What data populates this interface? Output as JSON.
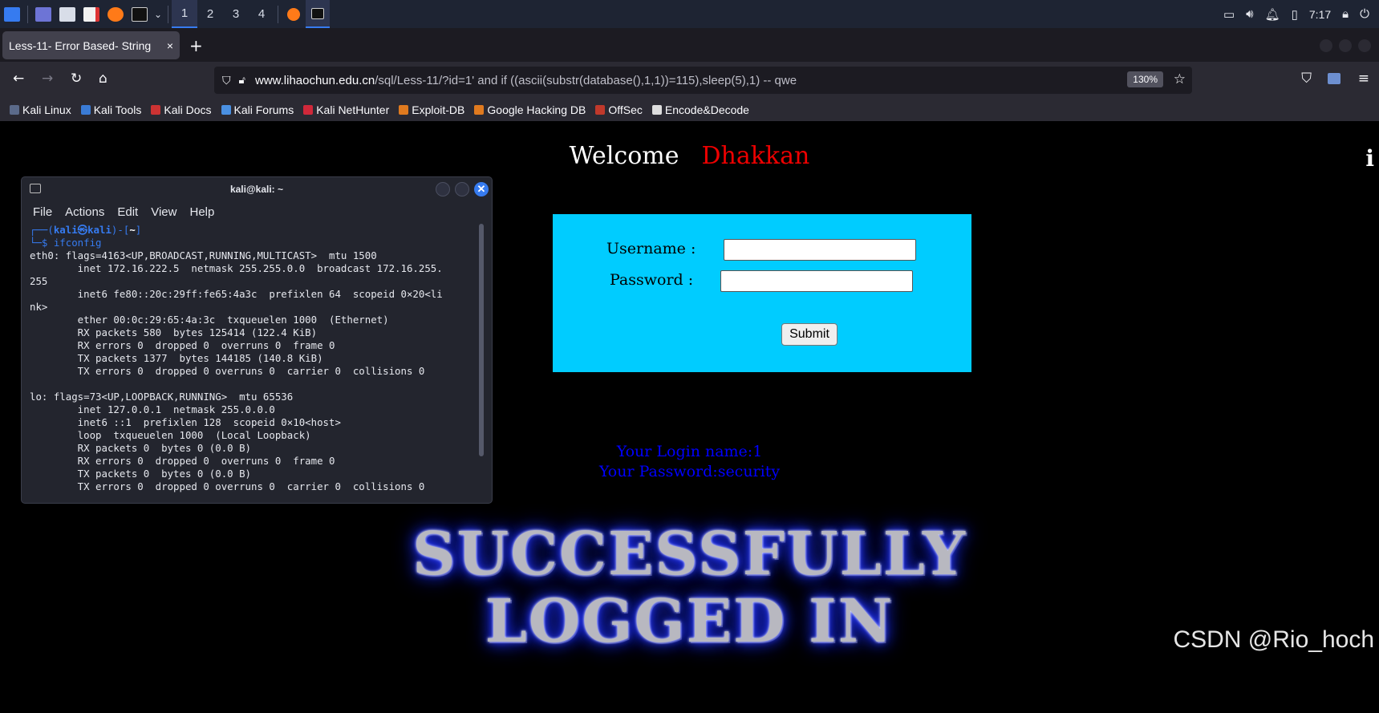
{
  "taskbar": {
    "workspaces": [
      "1",
      "2",
      "3",
      "4"
    ],
    "active_workspace": "1",
    "clock": "7:17"
  },
  "browser": {
    "tab_title": "Less-11- Error Based- String",
    "tab_close": "×",
    "new_tab": "+",
    "url_host": "www.lihaochun.edu.cn",
    "url_path": "/sql/Less-11/?id=1' and if ((ascii(substr(database(),1,1))=115),sleep(5),1) -- qwe",
    "zoom": "130%",
    "bookmarks": [
      {
        "label": "Kali Linux",
        "color": "#5b6a8a"
      },
      {
        "label": "Kali Tools",
        "color": "#3a7bd5"
      },
      {
        "label": "Kali Docs",
        "color": "#cc3333"
      },
      {
        "label": "Kali Forums",
        "color": "#4a90e2"
      },
      {
        "label": "Kali NetHunter",
        "color": "#d0283a"
      },
      {
        "label": "Exploit-DB",
        "color": "#e07a1f"
      },
      {
        "label": "Google Hacking DB",
        "color": "#e07a1f"
      },
      {
        "label": "OffSec",
        "color": "#c0392b"
      },
      {
        "label": "Encode&Decode",
        "color": "#dddddd"
      }
    ]
  },
  "page": {
    "welcome": "Welcome",
    "welcome_name": "Dhakkan",
    "username_label": "Username :",
    "password_label": "Password :",
    "submit_label": "Submit",
    "login_name": "Your Login name:1",
    "login_password": "Your Password:security",
    "banner_line1": "SUCCESSFULLY",
    "banner_line2": "LOGGED IN",
    "info_glyph": "i",
    "watermark": "CSDN @Rio_hoch"
  },
  "terminal": {
    "title": "kali@kali: ~",
    "menu": [
      "File",
      "Actions",
      "Edit",
      "View",
      "Help"
    ],
    "prompt_open": "┌──(",
    "prompt_user": "kali㉿kali",
    "prompt_mid": ")-[",
    "prompt_dir": "~",
    "prompt_close": "]",
    "prompt_line2": "└─$ ",
    "command": "ifconfig",
    "output": [
      "eth0: flags=4163<UP,BROADCAST,RUNNING,MULTICAST>  mtu 1500",
      "        inet 172.16.222.5  netmask 255.255.0.0  broadcast 172.16.255.",
      "255",
      "        inet6 fe80::20c:29ff:fe65:4a3c  prefixlen 64  scopeid 0×20<li",
      "nk>",
      "        ether 00:0c:29:65:4a:3c  txqueuelen 1000  (Ethernet)",
      "        RX packets 580  bytes 125414 (122.4 KiB)",
      "        RX errors 0  dropped 0  overruns 0  frame 0",
      "        TX packets 1377  bytes 144185 (140.8 KiB)",
      "        TX errors 0  dropped 0 overruns 0  carrier 0  collisions 0",
      "",
      "lo: flags=73<UP,LOOPBACK,RUNNING>  mtu 65536",
      "        inet 127.0.0.1  netmask 255.0.0.0",
      "        inet6 ::1  prefixlen 128  scopeid 0×10<host>",
      "        loop  txqueuelen 1000  (Local Loopback)",
      "        RX packets 0  bytes 0 (0.0 B)",
      "        RX errors 0  dropped 0  overruns 0  frame 0",
      "        TX packets 0  bytes 0 (0.0 B)",
      "        TX errors 0  dropped 0 overruns 0  carrier 0  collisions 0"
    ]
  },
  "colors": {
    "login_box": "#00ccff",
    "accent": "#367bf0",
    "login_info": "#0000ff",
    "welcome_name": "#ee0000"
  }
}
